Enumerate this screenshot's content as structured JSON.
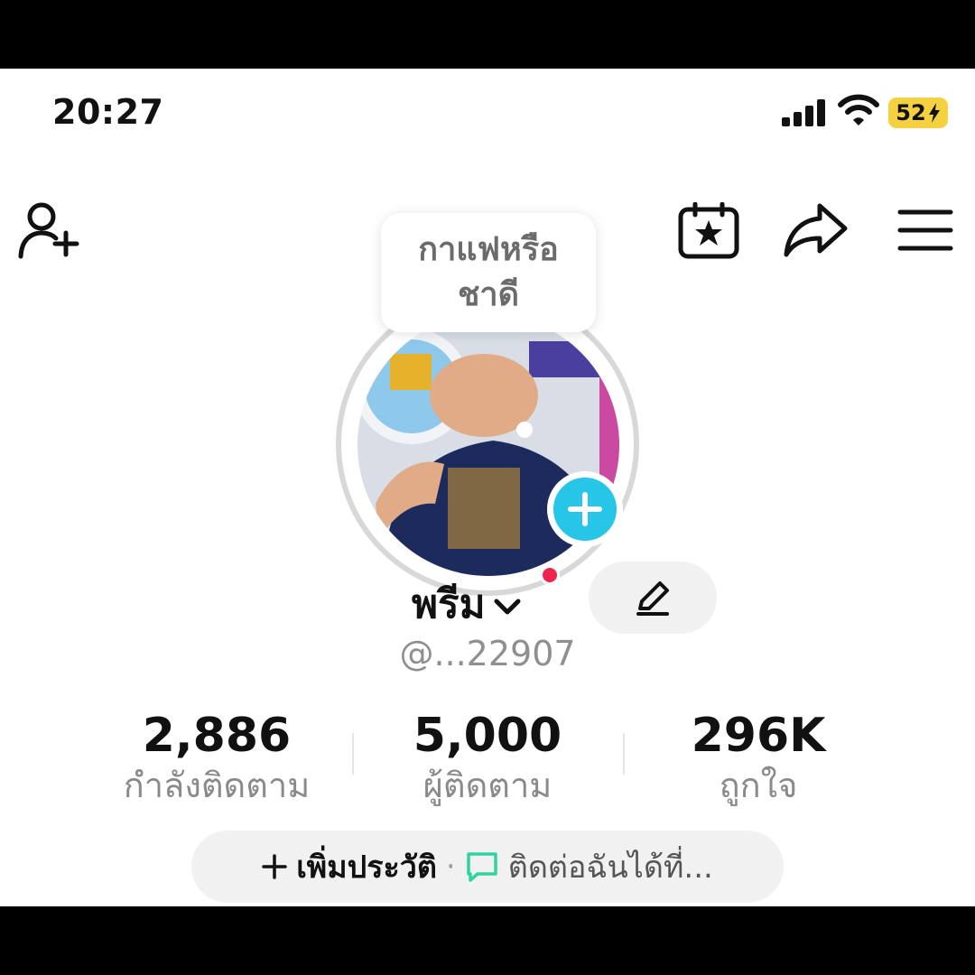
{
  "status_bar": {
    "time": "20:27",
    "battery": "52"
  },
  "top_nav": {
    "icons": [
      "add-friend-icon",
      "calendar-star-icon",
      "share-icon",
      "menu-icon"
    ]
  },
  "profile": {
    "note_line1": "กาแฟหรือ",
    "note_line2": "ชาดี",
    "display_name": "พรีม",
    "handle": "@...22907"
  },
  "stats": [
    {
      "value": "2,886",
      "label": "กำลังติดตาม"
    },
    {
      "value": "5,000",
      "label": "ผู้ติดตาม"
    },
    {
      "value": "296K",
      "label": "ถูกใจ"
    }
  ],
  "bio": {
    "add_label": "เพิ่มประวัติ",
    "separator": "·",
    "contact_label": "ติดต่อฉันได้ที่..."
  },
  "colors": {
    "accent": "#27c5e8",
    "notification": "#f0254f",
    "battery": "#f5d142",
    "contact_icon": "#2fd3a0"
  }
}
